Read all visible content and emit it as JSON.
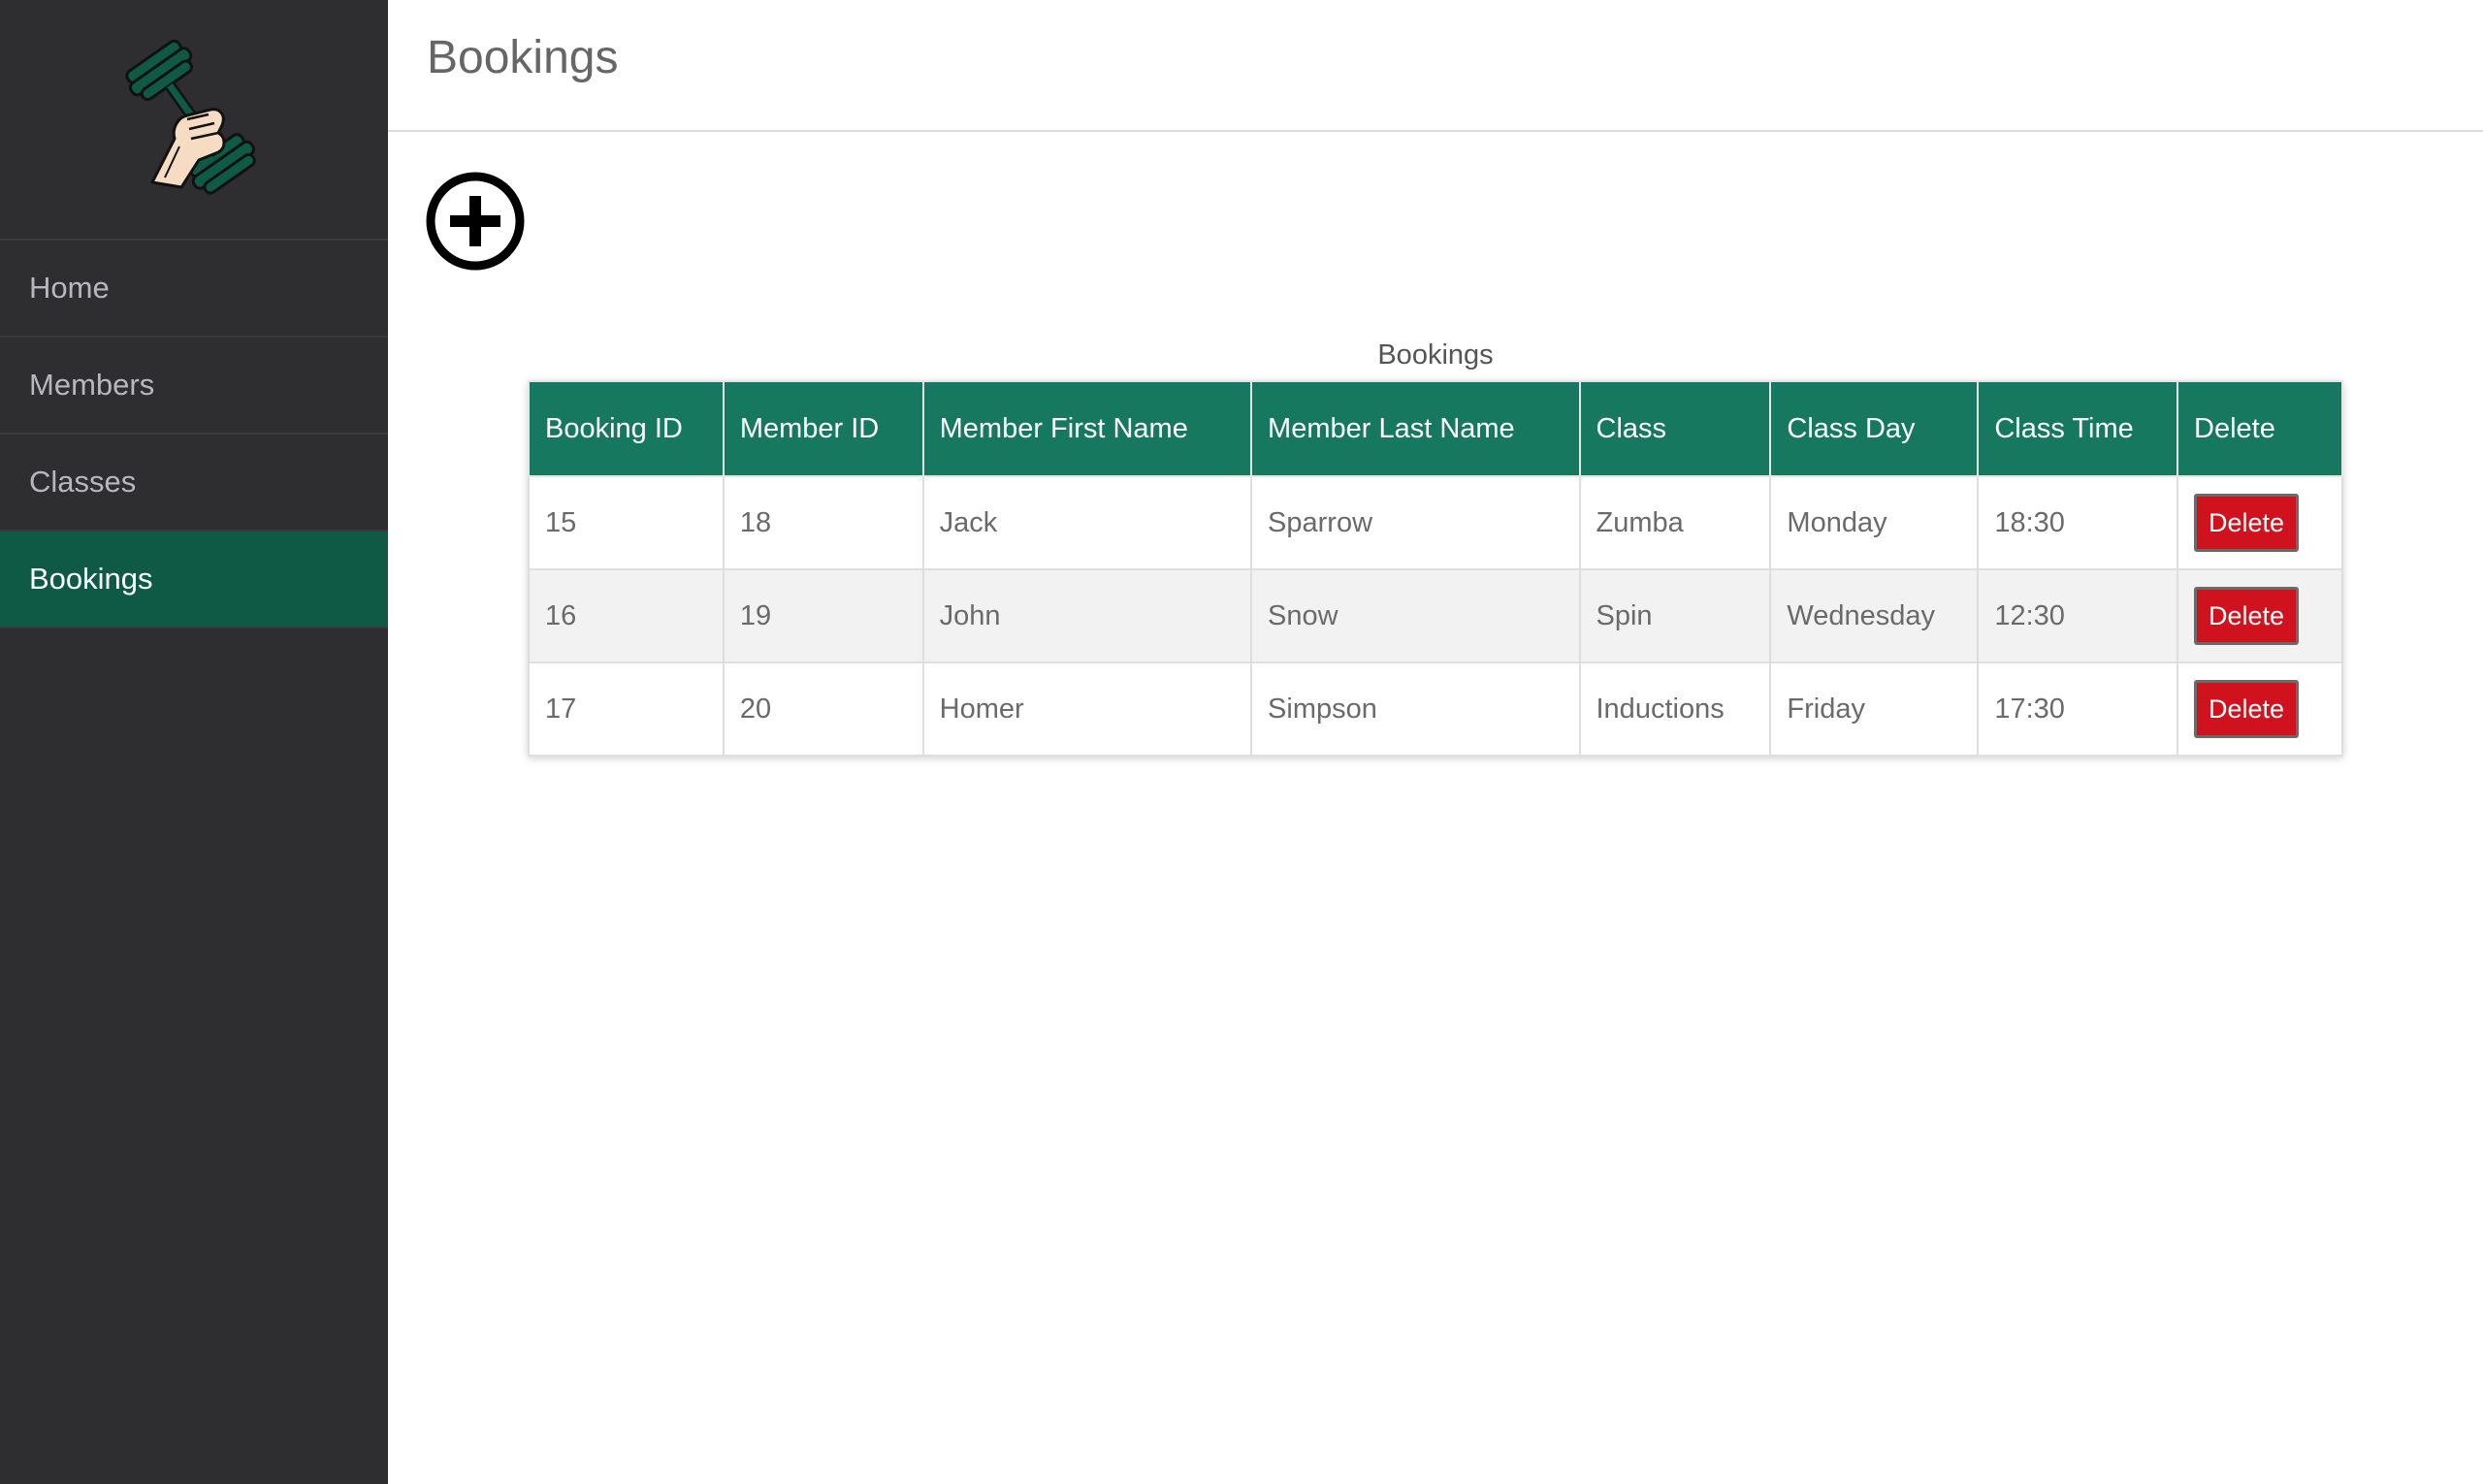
{
  "sidebar": {
    "items": [
      {
        "label": "Home"
      },
      {
        "label": "Members"
      },
      {
        "label": "Classes"
      },
      {
        "label": "Bookings"
      }
    ],
    "active_index": 3
  },
  "header": {
    "title": "Bookings"
  },
  "actions": {
    "add_icon": "plus-circle-icon"
  },
  "table": {
    "caption": "Bookings",
    "columns": [
      "Booking ID",
      "Member ID",
      "Member First Name",
      "Member Last Name",
      "Class",
      "Class Day",
      "Class Time",
      "Delete"
    ],
    "rows": [
      {
        "booking_id": "15",
        "member_id": "18",
        "first_name": "Jack",
        "last_name": "Sparrow",
        "class": "Zumba",
        "day": "Monday",
        "time": "18:30",
        "delete_label": "Delete"
      },
      {
        "booking_id": "16",
        "member_id": "19",
        "first_name": "John",
        "last_name": "Snow",
        "class": "Spin",
        "day": "Wednesday",
        "time": "12:30",
        "delete_label": "Delete"
      },
      {
        "booking_id": "17",
        "member_id": "20",
        "first_name": "Homer",
        "last_name": "Simpson",
        "class": "Inductions",
        "day": "Friday",
        "time": "17:30",
        "delete_label": "Delete"
      }
    ]
  },
  "colors": {
    "sidebar_bg": "#2e2e30",
    "active_nav": "#0f5a45",
    "table_header": "#177860",
    "delete_button": "#d0121f"
  }
}
